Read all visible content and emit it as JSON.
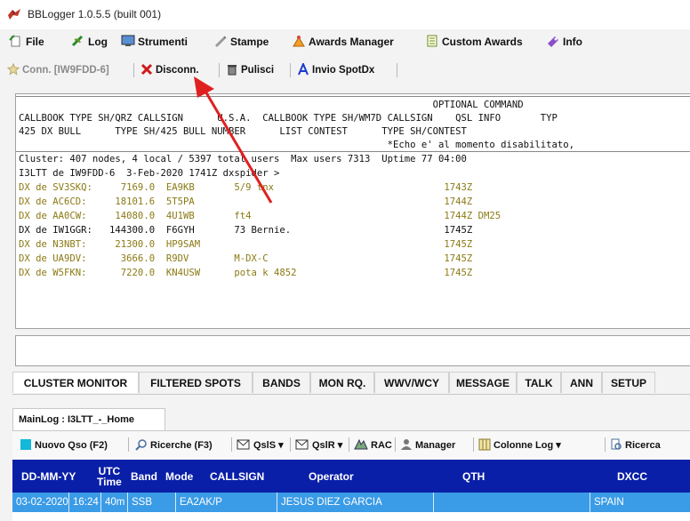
{
  "window": {
    "title": "BBLogger 1.0.5.5 (built 001)"
  },
  "menu": {
    "items": [
      {
        "label": "File"
      },
      {
        "label": "Log"
      },
      {
        "label": "Strumenti"
      },
      {
        "label": "Stampe"
      },
      {
        "label": "Awards Manager"
      },
      {
        "label": "Custom Awards"
      },
      {
        "label": "Info"
      }
    ]
  },
  "toolbar": {
    "conn_label": "Conn. [IW9FDD-6]",
    "disconn_label": "Disconn.",
    "pulisci_label": "Pulisci",
    "invio_label": "Invio SpotDx"
  },
  "console": {
    "lines": [
      "                                                                         OPTIONAL COMMAND",
      "CALLBOOK TYPE SH/QRZ CALLSIGN      U.S.A.  CALLBOOK TYPE SH/WM7D CALLSIGN    QSL INFO       TYP",
      "425 DX BULL      TYPE SH/425 BULL NUMBER      LIST CONTEST      TYPE SH/CONTEST",
      "                                                                 *Echo e' al momento disabilitato,",
      "Cluster: 407 nodes, 4 local / 5397 total users  Max users 7313  Uptime 77 04:00",
      "I3LTT de IW9FDD-6  3-Feb-2020 1741Z dxspider >"
    ],
    "spots": [
      {
        "text": "DX de SV3SKQ:     7169.0  EA9KB       5/9 tnx                              1743Z",
        "highlight": false
      },
      {
        "text": "DX de AC6CD:     18101.6  5T5PA                                            1744Z",
        "highlight": false
      },
      {
        "text": "DX de AA0CW:     14080.0  4U1WB       ft4                                  1744Z DM25",
        "highlight": false
      },
      {
        "text": "DX de IW1GGR:   144300.0  F6GYH       73 Bernie.                           1745Z",
        "highlight": true
      },
      {
        "text": "DX de N3NBT:     21300.0  HP9SAM                                           1745Z",
        "highlight": false
      },
      {
        "text": "DX de UA9DV:      3666.0  R9DV        M-DX-C                               1745Z",
        "highlight": false
      },
      {
        "text": "DX de W5FKN:      7220.0  KN4USW      pota k 4852                          1745Z",
        "highlight": false
      }
    ]
  },
  "tabs": [
    {
      "label": "CLUSTER MONITOR",
      "active": true
    },
    {
      "label": "FILTERED SPOTS",
      "active": false
    },
    {
      "label": "BANDS",
      "active": false
    },
    {
      "label": "MON RQ.",
      "active": false
    },
    {
      "label": "WWV/WCY",
      "active": false
    },
    {
      "label": "MESSAGE",
      "active": false
    },
    {
      "label": "TALK",
      "active": false
    },
    {
      "label": "ANN",
      "active": false
    },
    {
      "label": "SETUP",
      "active": false
    }
  ],
  "log": {
    "tab_label": "MainLog : I3LTT_-_Home",
    "toolbar": {
      "nuovo": "Nuovo Qso (F2)",
      "ricerche": "Ricerche (F3)",
      "qsls": "QslS",
      "qslr": "QslR",
      "rac": "RAC",
      "manager": "Manager",
      "colonne": "Colonne Log",
      "ricerca": "Ricerca"
    },
    "columns": [
      "DD-MM-YY",
      "UTC Time",
      "Band",
      "Mode",
      "CALLSIGN",
      "Operator",
      "QTH",
      "DXCC"
    ],
    "utc_line1": "UTC",
    "utc_line2": "Time",
    "rows": [
      [
        "03-02-2020",
        "16:24",
        "40m",
        "SSB",
        "EA2AK/P",
        "JESUS DIEZ GARCIA",
        "",
        "SPAIN"
      ]
    ]
  },
  "colors": {
    "grid_header": "#0a1fa8",
    "selected_row": "#3a9be6",
    "spot_text": "#8a7a14",
    "arrow": "#e02020"
  }
}
